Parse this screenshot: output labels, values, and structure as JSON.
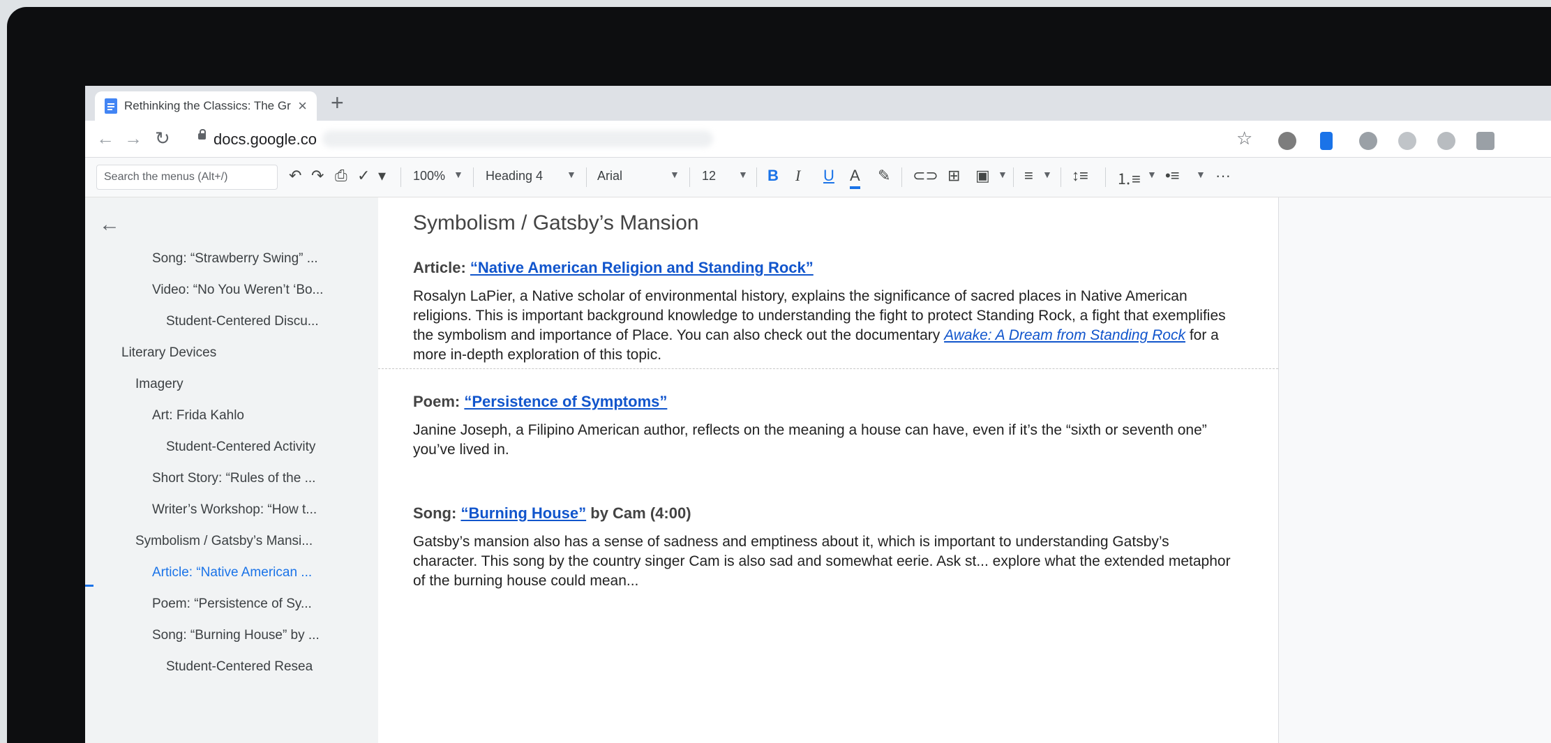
{
  "browser": {
    "tab_title": "Rethinking the Classics: The Grea",
    "tab_close": "×",
    "new_tab": "+",
    "url": "docs.google.co"
  },
  "toolbar": {
    "search_placeholder": "Search the menus (Alt+/)",
    "zoom": "100%",
    "style": "Heading 4",
    "font": "Arial",
    "font_size": "12",
    "bold": "B",
    "italic": "I",
    "underline": "U",
    "text_color": "A",
    "more": "···"
  },
  "outline": {
    "items": [
      {
        "label": "Song: “Strawberry Swing” ..."
      },
      {
        "label": "Video: “No You Weren’t ‘Bo..."
      },
      {
        "label": "Student-Centered Discu..."
      },
      {
        "label": "Literary Devices"
      },
      {
        "label": "Imagery"
      },
      {
        "label": "Art: Frida Kahlo"
      },
      {
        "label": "Student-Centered Activity"
      },
      {
        "label": "Short Story: “Rules of the ..."
      },
      {
        "label": "Writer’s Workshop: “How t..."
      },
      {
        "label": "Symbolism / Gatsby’s Mansi..."
      },
      {
        "label": "Article: “Native American ..."
      },
      {
        "label": "Poem: “Persistence of Sy..."
      },
      {
        "label": "Song: “Burning House” by ..."
      },
      {
        "label": "Student-Centered Resea"
      }
    ]
  },
  "document": {
    "heading": "Symbolism / Gatsby’s Mansion",
    "article": {
      "prefix": "Article:",
      "link": "“Native American Religion and Standing Rock”",
      "body_before": "Rosalyn LaPier, a Native scholar of environmental history, explains the significance of sacred places in Native American religions. This is important background knowledge to understanding the fight to protect Standing Rock, a fight that exemplifies the symbolism and importance of Place. You can also check out the documentary ",
      "body_link": "Awake: A Dream from Standing Rock",
      "body_after": " for a more in-depth exploration of this topic."
    },
    "poem": {
      "prefix": "Poem:",
      "link": "“Persistence of Symptoms”",
      "body": "Janine Joseph, a Filipino American author, reflects on the meaning a house can have, even if it’s the “sixth or seventh one” you’ve lived in."
    },
    "song": {
      "prefix": "Song:",
      "link": "“Burning House”",
      "suffix": "by Cam (4:00)",
      "body": "Gatsby’s mansion also has a sense of sadness and emptiness about it, which is important to understanding Gatsby’s character. This song by the country singer Cam is also sad and somewhat eerie. Ask st... explore what the extended metaphor of the burning house could mean..."
    }
  },
  "colors": {
    "link": "#1155cc",
    "accent": "#1a73e8"
  }
}
